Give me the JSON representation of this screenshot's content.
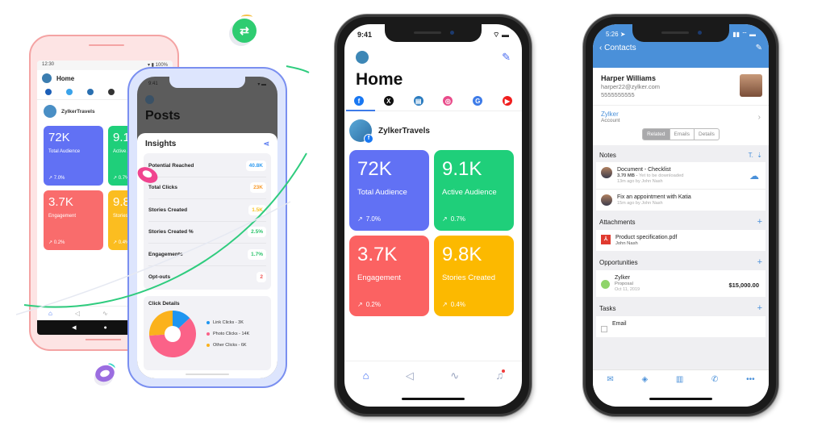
{
  "android_phone": {
    "status_time": "12:30",
    "status_battery": "100%",
    "title": "Home",
    "profile_name": "ZylkerTravels",
    "tabs": [
      "facebook",
      "twitter",
      "linkedin",
      "instagram"
    ],
    "cards": [
      {
        "value": "72K",
        "label": "Total Audience",
        "trend": "7.0%",
        "color": "#6171f4"
      },
      {
        "value": "9.1K",
        "label": "Active Audience",
        "trend": "0.7%",
        "color": "#1fcf7a"
      },
      {
        "value": "3.7K",
        "label": "Engagement",
        "trend": "0.2%",
        "color": "#f96c6c"
      },
      {
        "value": "9.8K",
        "label": "Stories Created",
        "trend": "0.4%",
        "color": "#fbbd20"
      }
    ]
  },
  "posts_phone": {
    "status_time": "9:41",
    "title": "Posts",
    "insights_title": "Insights",
    "insights": [
      {
        "label": "Potential Reached",
        "value": "40.8K",
        "color": "#2f9bf0"
      },
      {
        "label": "Total Clicks",
        "value": "23K",
        "color": "#f79a2c"
      },
      {
        "label": "Stories Created",
        "value": "1.5K",
        "color": "#f7c325"
      },
      {
        "label": "Stories Created %",
        "value": "2.5%",
        "color": "#2bc36b"
      },
      {
        "label": "Engagements",
        "value": "1.7%",
        "color": "#2bc36b"
      },
      {
        "label": "Opt-outs",
        "value": "2",
        "color": "#f05454"
      }
    ],
    "click_details": {
      "title": "Click Details",
      "legend": [
        {
          "label": "Link Clicks - 3K",
          "value": 3,
          "color": "#1f95f0"
        },
        {
          "label": "Photo Clicks - 14K",
          "value": 14,
          "color": "#fb6288"
        },
        {
          "label": "Other Clicks - 6K",
          "value": 6,
          "color": "#fbb21c"
        }
      ]
    }
  },
  "home_phone": {
    "status_time": "9:41",
    "title": "Home",
    "profile_name": "ZylkerTravels",
    "tabs": [
      {
        "name": "facebook",
        "glyph": "f",
        "color": "#1877f2"
      },
      {
        "name": "x",
        "glyph": "X",
        "color": "#111111"
      },
      {
        "name": "linkedin",
        "glyph": "▤",
        "color": "#2a7bbf"
      },
      {
        "name": "instagram",
        "glyph": "◎",
        "color": "#e94b8a"
      },
      {
        "name": "google",
        "glyph": "G",
        "color": "#3d7be8"
      },
      {
        "name": "youtube",
        "glyph": "▶",
        "color": "#f01d1d"
      }
    ],
    "cards": [
      {
        "value": "72K",
        "label": "Total Audience",
        "trend": "7.0%",
        "color": "#6171f4"
      },
      {
        "value": "9.1K",
        "label": "Active Audience",
        "trend": "0.7%",
        "color": "#1fcf7a"
      },
      {
        "value": "3.7K",
        "label": "Engagement",
        "trend": "0.2%",
        "color": "#fb6262"
      },
      {
        "value": "9.8K",
        "label": "Stories Created",
        "trend": "0.4%",
        "color": "#fcb900"
      }
    ],
    "nav": [
      "home",
      "megaphone",
      "activity",
      "bell"
    ]
  },
  "crm_phone": {
    "status_time": "5:26",
    "back_label": "Contacts",
    "contact": {
      "name": "Harper Williams",
      "email": "harper22@zylker.com",
      "phone": "5555555555"
    },
    "account": {
      "name": "Zylker",
      "label": "Account"
    },
    "segments": [
      {
        "label": "Related",
        "active": true
      },
      {
        "label": "Emails",
        "active": false
      },
      {
        "label": "Details",
        "active": false
      }
    ],
    "notes": {
      "title": "Notes",
      "items": [
        {
          "title": "Document - Checklist",
          "size": "3.70 MB",
          "status": "Yet to be downloaded",
          "meta": "13m ago by John Nash"
        },
        {
          "title": "Fix an appointment with Katia",
          "meta": "15m ago by John Nash"
        }
      ]
    },
    "attachments": {
      "title": "Attachments",
      "items": [
        {
          "title": "Product specification.pdf",
          "owner": "John Nash"
        }
      ]
    },
    "opportunities": {
      "title": "Opportunities",
      "items": [
        {
          "name": "Zylker",
          "stage": "Proposal",
          "date": "Oct 11, 2019",
          "amount": "$15,000.00"
        }
      ]
    },
    "tasks": {
      "title": "Tasks",
      "items": [
        {
          "title": "Email"
        }
      ]
    },
    "tabbar": [
      "mail",
      "check",
      "map",
      "phone",
      "more"
    ]
  }
}
